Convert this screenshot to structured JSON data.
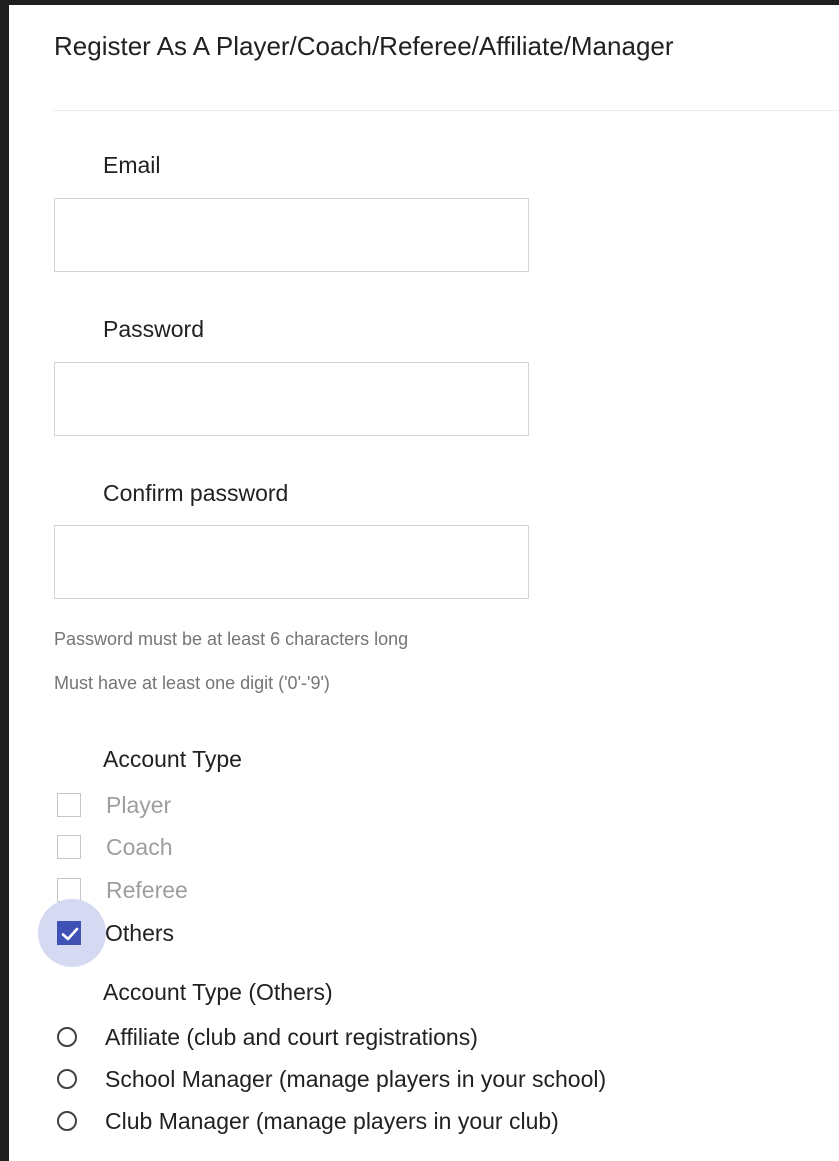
{
  "form": {
    "title": "Register As A Player/Coach/Referee/Affiliate/Manager",
    "fields": {
      "email": {
        "label": "Email",
        "value": "",
        "placeholder": ""
      },
      "password": {
        "label": "Password",
        "value": "",
        "placeholder": ""
      },
      "confirm_password": {
        "label": "Confirm password",
        "value": "",
        "placeholder": ""
      }
    },
    "hints": [
      "Password must be at least 6 characters long",
      "Must have at least one digit ('0'-'9')"
    ],
    "account_type": {
      "label": "Account Type",
      "options": [
        {
          "label": "Player",
          "checked": false
        },
        {
          "label": "Coach",
          "checked": false
        },
        {
          "label": "Referee",
          "checked": false
        },
        {
          "label": "Others",
          "checked": true
        }
      ]
    },
    "account_type_others": {
      "label": "Account Type (Others)",
      "options": [
        {
          "label": "Affiliate (club and court registrations)",
          "selected": false
        },
        {
          "label": "School Manager (manage players in your school)",
          "selected": false
        },
        {
          "label": "Club Manager (manage players in your club)",
          "selected": false
        }
      ]
    },
    "colors": {
      "accent": "#3f51b5",
      "focus_halo": "#d6d9f2",
      "text": "#212121",
      "muted_text": "#9e9e9e",
      "hint_text": "#757575",
      "border": "#d4d4d4"
    },
    "icons": {
      "checkbox_checked": "check-icon",
      "radio_unselected": "radio-empty-icon"
    }
  }
}
